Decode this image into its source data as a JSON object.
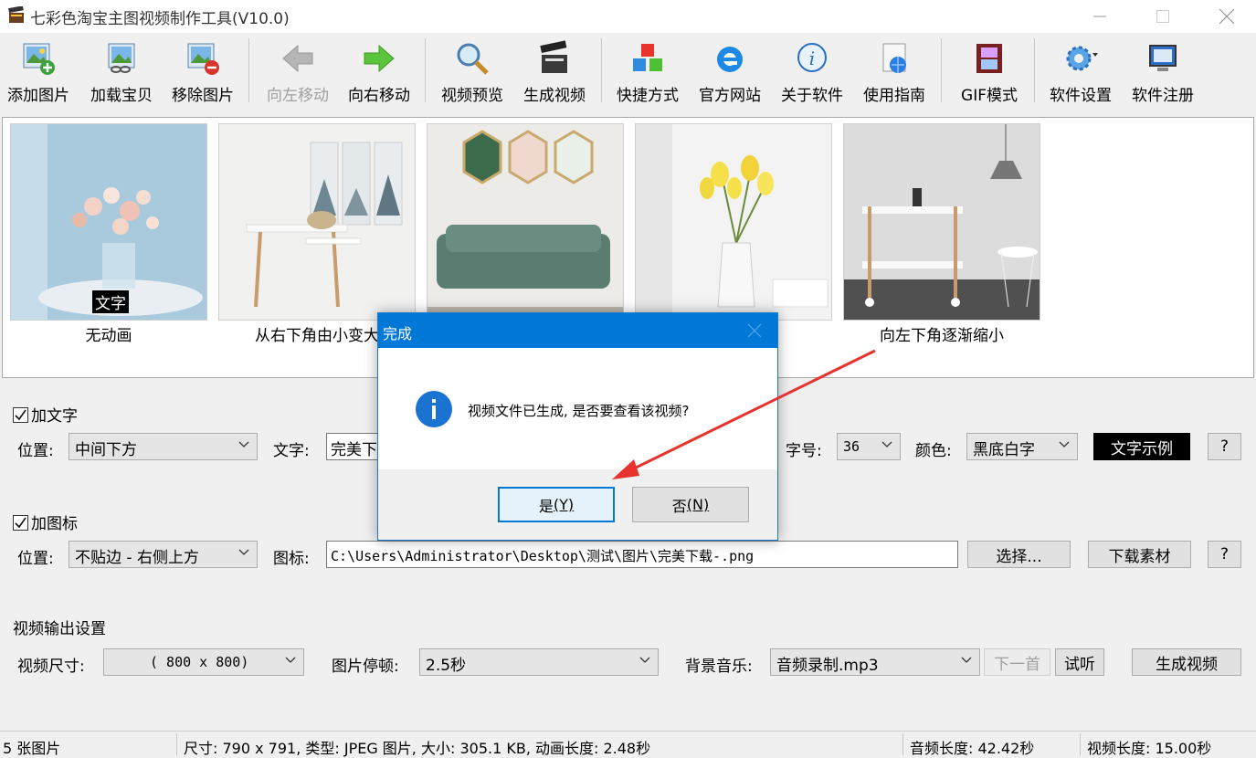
{
  "window": {
    "title": "七彩色淘宝主图视频制作工具(V10.0)"
  },
  "toolbar": {
    "items": [
      {
        "label": "添加图片",
        "icon": "add-image-icon",
        "enabled": true
      },
      {
        "label": "加载宝贝",
        "icon": "load-item-icon",
        "enabled": true
      },
      {
        "label": "移除图片",
        "icon": "remove-image-icon",
        "enabled": true
      },
      {
        "label": "向左移动",
        "icon": "arrow-left-icon",
        "enabled": false
      },
      {
        "label": "向右移动",
        "icon": "arrow-right-icon",
        "enabled": true
      },
      {
        "label": "视频预览",
        "icon": "magnifier-icon",
        "enabled": true
      },
      {
        "label": "生成视频",
        "icon": "clapperboard-icon",
        "enabled": true
      },
      {
        "label": "快捷方式",
        "icon": "cubes-icon",
        "enabled": true
      },
      {
        "label": "官方网站",
        "icon": "ie-browser-icon",
        "enabled": true
      },
      {
        "label": "关于软件",
        "icon": "info-icon",
        "enabled": true
      },
      {
        "label": "使用指南",
        "icon": "http-globe-icon",
        "enabled": true
      },
      {
        "label": "GIF模式",
        "icon": "film-icon",
        "enabled": true
      },
      {
        "label": "软件设置",
        "icon": "gear-icon",
        "enabled": true
      },
      {
        "label": "软件注册",
        "icon": "monitor-icon",
        "enabled": true
      }
    ]
  },
  "thumbnails": [
    {
      "caption": "无动画",
      "overlay": "文字"
    },
    {
      "caption": "从右下角由小变大",
      "overlay": ""
    },
    {
      "caption": "",
      "overlay": ""
    },
    {
      "caption": "出",
      "overlay": ""
    },
    {
      "caption": "向左下角逐渐缩小",
      "overlay": ""
    }
  ],
  "text_section": {
    "title": "加文字",
    "checked": true,
    "position_label": "位置:",
    "position_value": "中间下方",
    "text_label": "文字:",
    "text_value": "完美下",
    "size_label": "字号:",
    "size_value": "36",
    "color_label": "颜色:",
    "color_value": "黑底白字",
    "sample_button": "文字示例",
    "help_button": "?"
  },
  "icon_section": {
    "title": "加图标",
    "checked": true,
    "position_label": "位置:",
    "position_value": "不贴边 - 右侧上方",
    "icon_label": "图标:",
    "icon_path": "C:\\Users\\Administrator\\Desktop\\测试\\图片\\完美下载-.png",
    "choose_button": "选择...",
    "download_button": "下载素材",
    "help_button": "?"
  },
  "output_section": {
    "title": "视频输出设置",
    "size_label": "视频尺寸:",
    "size_value": "( 800 x  800)",
    "pause_label": "图片停顿:",
    "pause_value": "2.5秒",
    "music_label": "背景音乐:",
    "music_value": "音频录制.mp3",
    "next_button": "下一首",
    "listen_button": "试听",
    "generate_button": "生成视频"
  },
  "statusbar": {
    "count": "5 张图片",
    "info": "尺寸: 790 x 791, 类型: JPEG 图片, 大小: 305.1 KB, 动画长度: 2.48秒",
    "audio": "音频长度: 42.42秒",
    "video": "视频长度: 15.00秒"
  },
  "dialog": {
    "title": "完成",
    "message": "视频文件已生成, 是否要查看该视频?",
    "yes_button": "是",
    "yes_hotkey": "(Y)",
    "no_button": "否",
    "no_hotkey": "(N)"
  },
  "colors": {
    "dialog_title_bg": "#0078d7",
    "annotation_arrow": "#e8322d",
    "sample_bg": "#000000"
  }
}
